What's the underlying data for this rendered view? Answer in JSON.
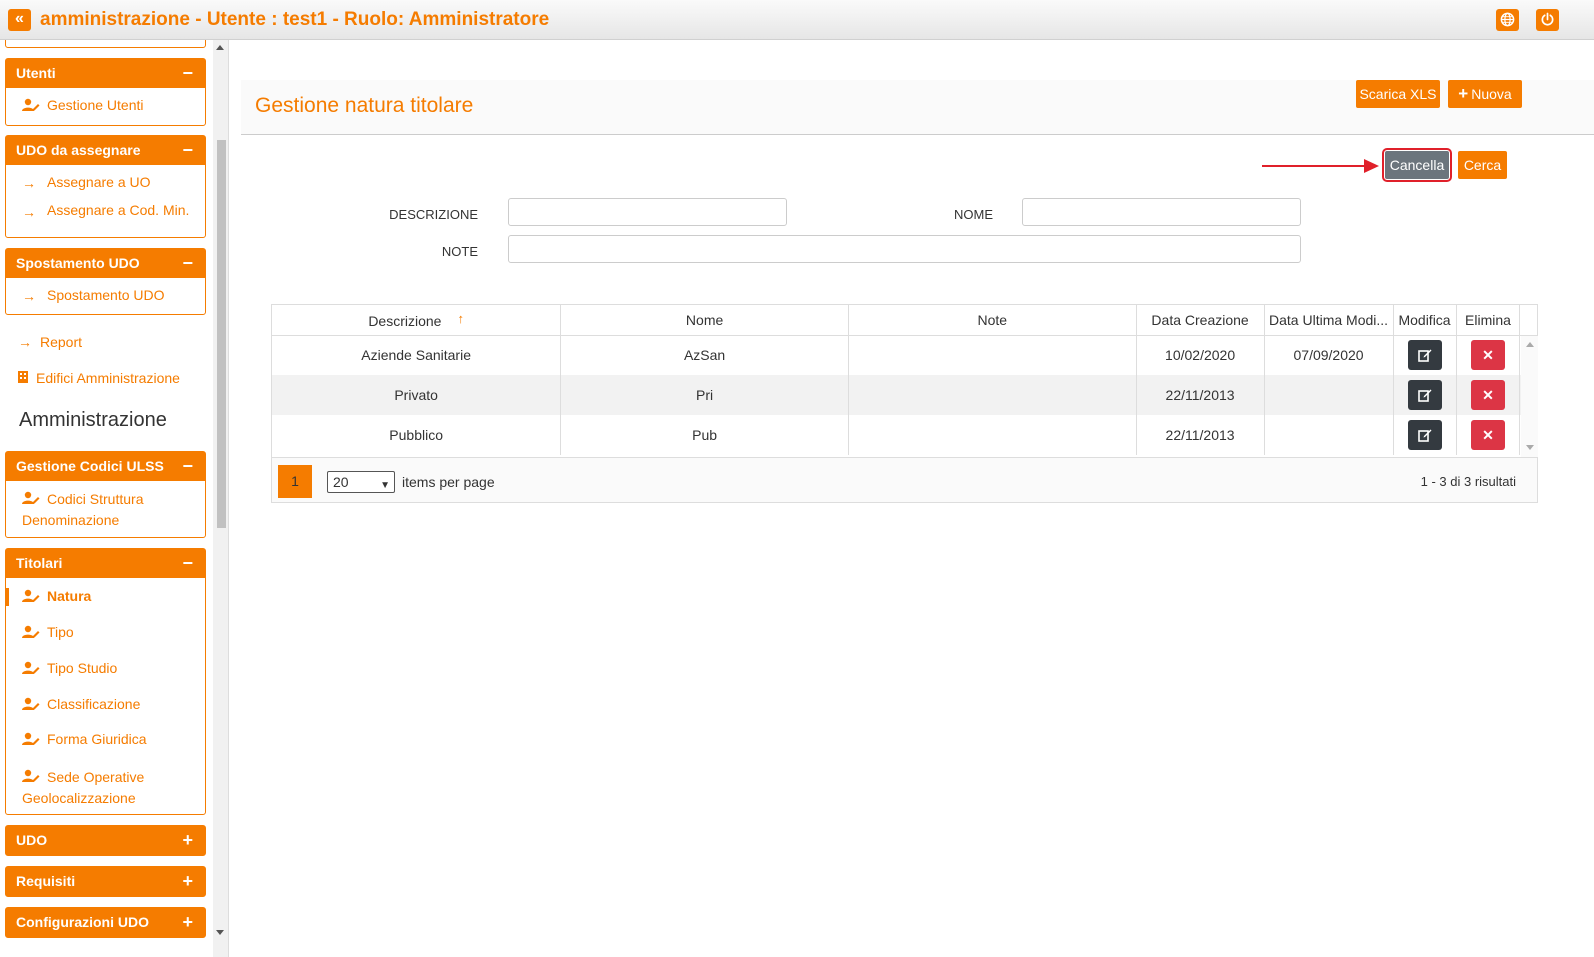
{
  "header": {
    "back_icon": "«",
    "title": "amministrazione - Utente : test1 - Ruolo: Amministratore",
    "globe_icon": "globe-icon",
    "power_icon": "power-icon",
    "accent": "#f57c00"
  },
  "sidebar": {
    "panels": [
      {
        "title": "Utenti",
        "sign": "−",
        "items": [
          "Gestione Utenti"
        ]
      },
      {
        "title": "UDO da assegnare",
        "sign": "−",
        "items": [
          "Assegnare a UO",
          "Assegnare a Cod. Min."
        ]
      },
      {
        "title": "Spostamento UDO",
        "sign": "−",
        "items": [
          "Spostamento UDO"
        ]
      },
      {
        "title": "Gestione Codici ULSS",
        "sign": "−",
        "items": [
          "Codici Struttura Denominazione"
        ]
      },
      {
        "title": "Titolari",
        "sign": "−",
        "items": [
          "Natura",
          "Tipo",
          "Tipo Studio",
          "Classificazione",
          "Forma Giuridica",
          "Sede Operative Geolocalizzazione"
        ]
      },
      {
        "title": "UDO",
        "sign": "+"
      },
      {
        "title": "Requisiti",
        "sign": "+"
      },
      {
        "title": "Configurazioni UDO",
        "sign": "+"
      }
    ],
    "links": [
      "Report",
      "Edifici Amministrazione"
    ],
    "section_title": "Amministrazione",
    "active_item": "Natura"
  },
  "main": {
    "title": "Gestione natura titolare",
    "btn_xls": "Scarica XLS",
    "btn_new": "Nuova",
    "btn_cancel": "Cancella",
    "btn_search": "Cerca",
    "filters": {
      "descrizione_label": "DESCRIZIONE",
      "nome_label": "NOME",
      "note_label": "NOTE",
      "descrizione_value": "",
      "nome_value": "",
      "note_value": ""
    }
  },
  "table": {
    "columns": [
      "Descrizione",
      "Nome",
      "Note",
      "Data Creazione",
      "Data Ultima Modi...",
      "Modifica",
      "Elimina"
    ],
    "rows": [
      [
        "Aziende Sanitarie",
        "AzSan",
        "",
        "10/02/2020",
        "07/09/2020"
      ],
      [
        "Privato",
        "Pri",
        "",
        "22/11/2013",
        ""
      ],
      [
        "Pubblico",
        "Pub",
        "",
        "22/11/2013",
        ""
      ]
    ],
    "delete_glyph": "✕",
    "page": "1",
    "page_size": "20",
    "items_per_page": "items per page",
    "results": "1 - 3 di 3 risultati"
  }
}
